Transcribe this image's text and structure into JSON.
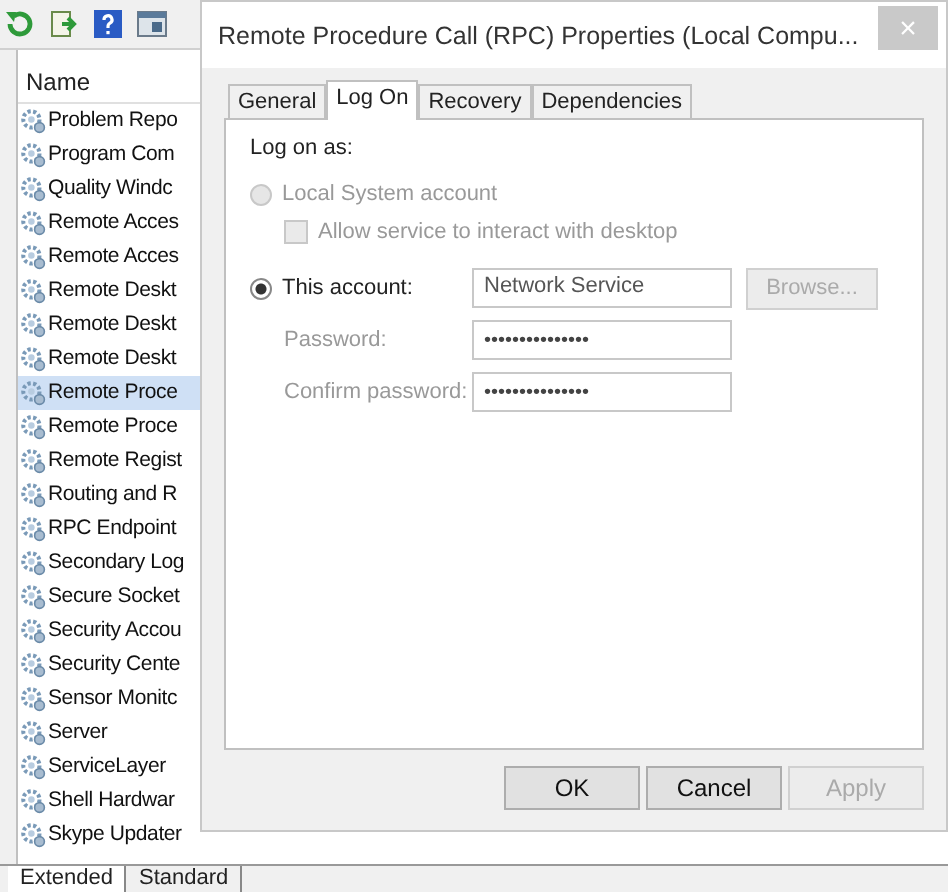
{
  "services": {
    "column": "Name",
    "items": [
      {
        "name": "Problem Repo",
        "selected": false
      },
      {
        "name": "Program Com",
        "selected": false
      },
      {
        "name": "Quality Windc",
        "selected": false
      },
      {
        "name": "Remote Acces",
        "selected": false
      },
      {
        "name": "Remote Acces",
        "selected": false
      },
      {
        "name": "Remote Deskt",
        "selected": false
      },
      {
        "name": "Remote Deskt",
        "selected": false
      },
      {
        "name": "Remote Deskt",
        "selected": false
      },
      {
        "name": "Remote Proce",
        "selected": true
      },
      {
        "name": "Remote Proce",
        "selected": false
      },
      {
        "name": "Remote Regist",
        "selected": false
      },
      {
        "name": "Routing and R",
        "selected": false
      },
      {
        "name": "RPC Endpoint",
        "selected": false
      },
      {
        "name": "Secondary Log",
        "selected": false
      },
      {
        "name": "Secure Socket",
        "selected": false
      },
      {
        "name": "Security Accou",
        "selected": false
      },
      {
        "name": "Security Cente",
        "selected": false
      },
      {
        "name": "Sensor Monitc",
        "selected": false
      },
      {
        "name": "Server",
        "selected": false
      },
      {
        "name": "ServiceLayer",
        "selected": false
      },
      {
        "name": "Shell Hardwar",
        "selected": false
      },
      {
        "name": "Skype Updater",
        "selected": false
      }
    ]
  },
  "bottom_tabs": [
    {
      "label": "Extended",
      "selected": true
    },
    {
      "label": "Standard",
      "selected": false
    }
  ],
  "dialog": {
    "title": "Remote Procedure Call (RPC) Properties (Local Compu...",
    "close": "×",
    "tabs": [
      {
        "label": "General",
        "selected": false
      },
      {
        "label": "Log On",
        "selected": true
      },
      {
        "label": "Recovery",
        "selected": false
      },
      {
        "label": "Dependencies",
        "selected": false
      }
    ],
    "log_on_as": "Log on as:",
    "local_system": {
      "label": "Local System account",
      "selected": false,
      "disabled": true
    },
    "interact_desktop": {
      "label": "Allow service to interact with desktop",
      "checked": false,
      "disabled": true
    },
    "this_account": {
      "label": "This account:",
      "selected": true,
      "disabled": false
    },
    "account": {
      "value": "Network Service"
    },
    "browse": {
      "label": "Browse...",
      "disabled": true
    },
    "password": {
      "label": "Password:",
      "value": "•••••••••••••••"
    },
    "confirm_password": {
      "label": "Confirm password:",
      "value": "•••••••••••••••"
    },
    "buttons": [
      {
        "label": "OK",
        "disabled": false
      },
      {
        "label": "Cancel",
        "disabled": false
      },
      {
        "label": "Apply",
        "disabled": true
      }
    ]
  }
}
